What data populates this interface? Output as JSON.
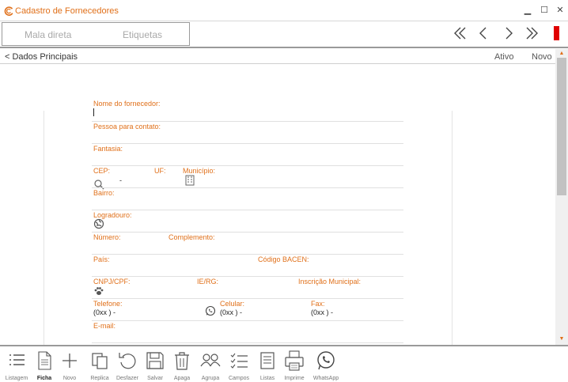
{
  "window": {
    "title": "Cadastro de Fornecedores",
    "accent": "#e0701a"
  },
  "toolbar": {
    "tabs": [
      {
        "label": "Mala direta"
      },
      {
        "label": "Etiquetas"
      }
    ],
    "nav": [
      "first-icon",
      "previous-icon",
      "next-icon",
      "last-icon"
    ]
  },
  "section": {
    "title": "< Dados Principais",
    "ativo": "Ativo",
    "novo": "Novo"
  },
  "form": {
    "nome_fornecedor": "Nome do fornecedor:",
    "pessoa_contato": "Pessoa para contato:",
    "fantasia": "Fantasia:",
    "cep": "CEP:",
    "cep_value": "-",
    "uf": "UF:",
    "municipio": "Município:",
    "bairro": "Bairro:",
    "logradouro": "Logradouro:",
    "numero": "Número:",
    "complemento": "Complemento:",
    "pais": "País:",
    "codigo_bacen": "Código BACEN:",
    "cnpj_cpf": "CNPJ/CPF:",
    "ie_rg": "IE/RG:",
    "inscricao_municipal": "Inscrição Municipal:",
    "telefone": "Telefone:",
    "telefone_value": "(0xx )   -",
    "celular": "Celular:",
    "celular_value": "(0xx )   -",
    "fax": "Fax:",
    "fax_value": "(0xx )   -",
    "email": "E-mail:"
  },
  "bottombar": {
    "buttons": [
      {
        "label": "Listagem",
        "icon": "list-icon"
      },
      {
        "label": "Ficha",
        "icon": "document-icon",
        "active": true
      },
      {
        "label": "Novo",
        "icon": "plus-icon"
      },
      {
        "label": "Replica",
        "icon": "copy-icon"
      },
      {
        "label": "Desfazer",
        "icon": "undo-icon"
      },
      {
        "label": "Salvar",
        "icon": "save-icon"
      },
      {
        "label": "Apaga",
        "icon": "trash-icon"
      },
      {
        "label": "Agrupa",
        "icon": "group-icon"
      },
      {
        "label": "Campos",
        "icon": "checklist-icon"
      },
      {
        "label": "Listas",
        "icon": "lists-icon"
      },
      {
        "label": "Imprime",
        "icon": "printer-icon"
      },
      {
        "label": "WhatsApp",
        "icon": "whatsapp-icon"
      }
    ]
  }
}
